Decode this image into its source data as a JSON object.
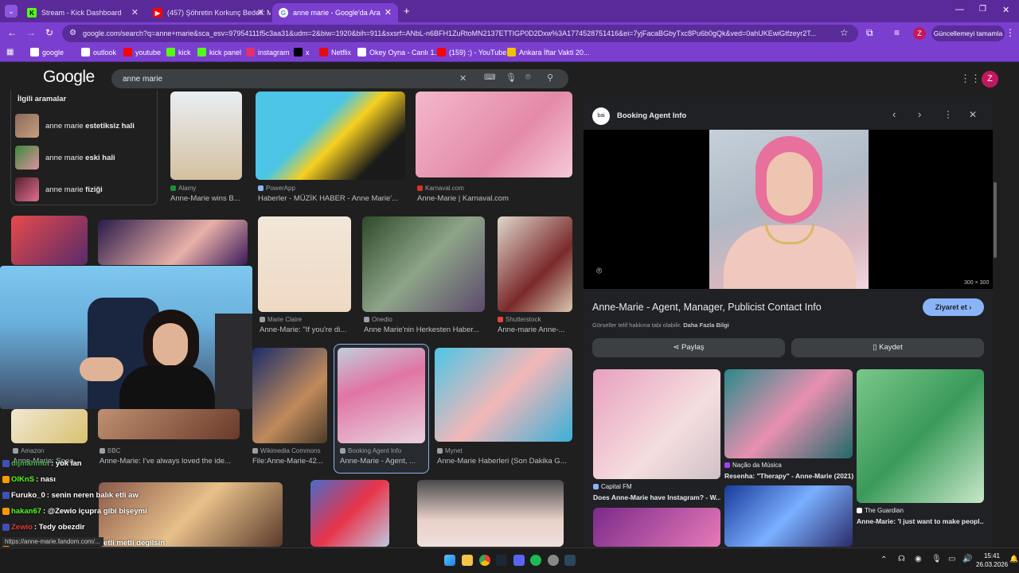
{
  "tabs": [
    {
      "label": "Stream - Kick Dashboard",
      "fav": "K",
      "favColor": "#53fc18"
    },
    {
      "label": "(457) Şöhretin Korkunç Bedeli: M",
      "fav": "▶",
      "favColor": "#ff0000"
    },
    {
      "label": "anne marie - Google'da Ara",
      "fav": "G",
      "favColor": "#ffffff"
    }
  ],
  "address": "google.com/search?q=anne+marie&sca_esv=97954111f5c3aa31&udm=2&biw=1920&bih=911&sxsrf=ANbL-n6BFH1ZuRtoMN2137ETTIGP0D2Dxw%3A1774528751416&ei=7yjFacaBGbyTxc8Pu6b0gQk&ved=0ahUKEwiGtfzeyr2T...",
  "profile_initial": "Z",
  "update_label": "Güncellemeyi tamamla",
  "bookmarks": [
    {
      "label": "google",
      "color": "#ffffff"
    },
    {
      "label": "outlook",
      "color": "#ffffff"
    },
    {
      "label": "youtube",
      "color": "#ff0000"
    },
    {
      "label": "kick",
      "color": "#53fc18"
    },
    {
      "label": "kick panel",
      "color": "#53fc18"
    },
    {
      "label": "instagram",
      "color": "#e1306c"
    },
    {
      "label": "x",
      "color": "#000000"
    },
    {
      "label": "Netflix",
      "color": "#e50914"
    },
    {
      "label": "Okey Oyna - Canlı 1...",
      "color": "#ffffff"
    },
    {
      "label": "(159) :) - YouTube",
      "color": "#ff0000"
    },
    {
      "label": "Ankara İftar Vakti 20...",
      "color": "#f2c200"
    }
  ],
  "google": {
    "logo": "Google",
    "query": "anne marie",
    "related_title": "İlgili aramalar",
    "related": [
      {
        "prefix": "anne marie ",
        "bold": "estetiksiz hali"
      },
      {
        "prefix": "anne marie ",
        "bold": "eski hali"
      },
      {
        "prefix": "anne marie ",
        "bold": "fiziği"
      }
    ],
    "results": [
      {
        "src": "Alamy",
        "title": "Anne-Marie wins B...",
        "srcColor": "#1e8e3e"
      },
      {
        "src": "PowerApp",
        "title": "Haberler - MÜZİK HABER - Anne Marie'...",
        "srcColor": "#8ab4f8"
      },
      {
        "src": "Karnaval.com",
        "title": "Anne-Marie | Karnaval.com",
        "srcColor": "#d93025"
      },
      {
        "src": "Marie Claire",
        "title": "Anne-Marie: \"If you're di...",
        "srcColor": "#9aa0a6"
      },
      {
        "src": "Onedio",
        "title": "Anne Marie'nin Herkesten Haber...",
        "srcColor": "#9aa0a6"
      },
      {
        "src": "Shutterstock",
        "title": "Anne-marie Anne-...",
        "srcColor": "#ea4335"
      },
      {
        "src": "Amazon",
        "title": "Anne-Marie: Spea...",
        "srcColor": "#9aa0a6"
      },
      {
        "src": "BBC",
        "title": "Anne-Marie: I've always loved the ide...",
        "srcColor": "#9aa0a6"
      },
      {
        "src": "Wikimedia Commons",
        "title": "File:Anne-Marie-42...",
        "srcColor": "#9aa0a6"
      },
      {
        "src": "Booking Agent Info",
        "title": "Anne-Marie - Agent, ...",
        "srcColor": "#9aa0a6"
      },
      {
        "src": "Mynet",
        "title": "Anne-Marie Haberleri (Son Dakika G...",
        "srcColor": "#9aa0a6"
      }
    ]
  },
  "panel": {
    "source": "Booking Agent Info",
    "size": "300 × 300",
    "title": "Anne-Marie - Agent, Manager, Publicist Contact Info",
    "visit": "Ziyaret et",
    "copyright": "Görseller telif hakkına tabi olabilir.",
    "more_info": "Daha Fazla Bilgi",
    "share": "Paylaş",
    "save": "Kaydet",
    "related": [
      {
        "src": "Capital FM",
        "title": "Does Anne-Marie have Instagram? - W..."
      },
      {
        "src": "Nação da Música",
        "title": "Resenha: \"Therapy\" - Anne-Marie (2021)"
      },
      {
        "src": "The Guardian",
        "title": "Anne-Marie: 'I just want to make peopl..."
      }
    ]
  },
  "chat": [
    {
      "user": "dijmahmut",
      "msg": ": yok lan",
      "color": "#4caf50"
    },
    {
      "user": "OlKnS",
      "msg": ": nası",
      "color": "#53fc18"
    },
    {
      "user": "Furuko_0",
      "msg": ": senin neren balık etli aw",
      "color": "#ffffff"
    },
    {
      "user": "hakan67",
      "msg": ": @Zewio içupra gibi bişeymi",
      "color": "#53fc18"
    },
    {
      "user": "Zewio",
      "msg": ": Tedy obezdir",
      "color": "#e53935"
    },
    {
      "user": "Furuko_0",
      "msg": ": nacı seri balık etli metli degilsin",
      "color": "#ffffff"
    }
  ],
  "status_url": "https://anne-marie.fandom.com/...",
  "clock": {
    "time": "15:41",
    "date": "26.03.2026"
  }
}
